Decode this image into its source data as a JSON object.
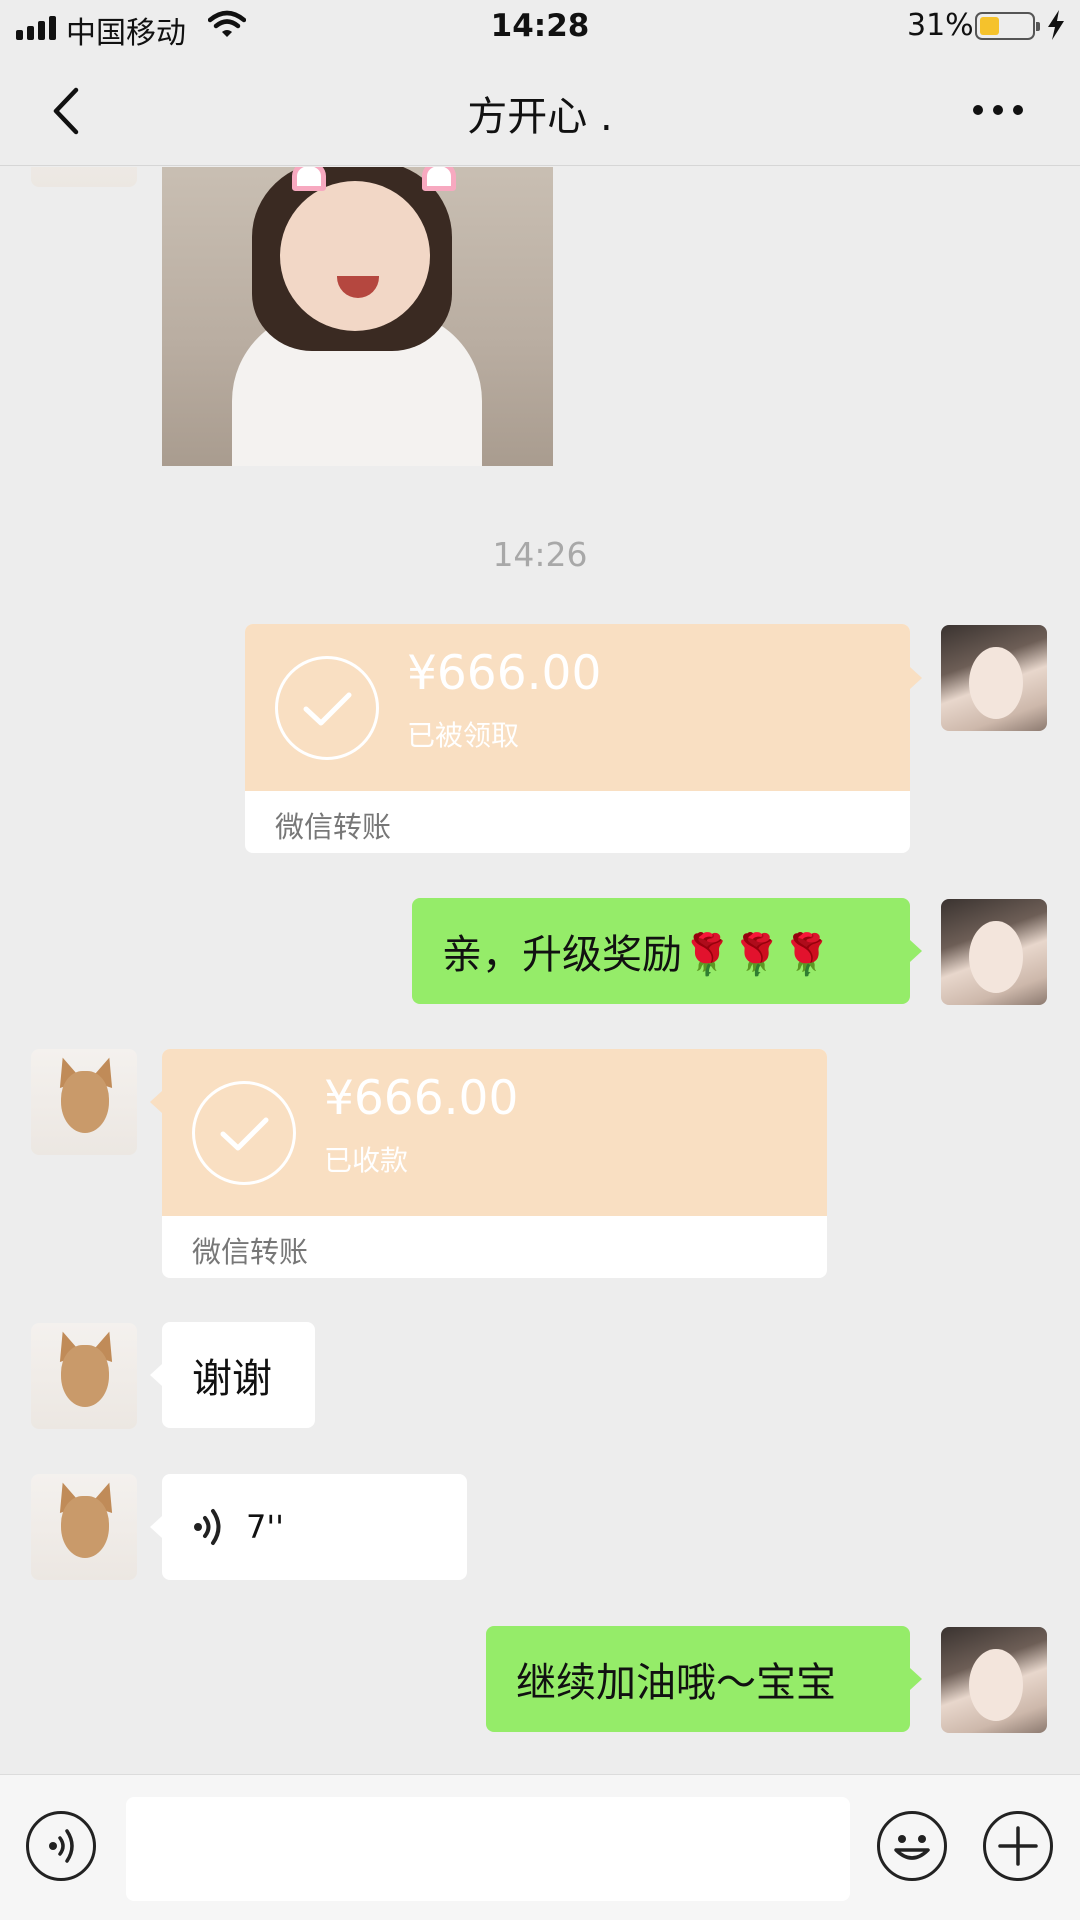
{
  "status_bar": {
    "carrier": "中国移动",
    "time": "14:28",
    "battery_percent": "31%",
    "battery_level": 0.31,
    "icons": [
      "signal-icon",
      "wifi-icon",
      "battery-icon",
      "charging-bolt-icon"
    ]
  },
  "nav": {
    "title": "方开心 .",
    "back_icon": "chevron-left-icon",
    "more_icon": "ellipsis-icon"
  },
  "chat": {
    "divider_time": "14:26",
    "messages": [
      {
        "type": "image",
        "side": "left",
        "sender": "contact",
        "description_icon": "photo"
      },
      {
        "type": "transfer",
        "side": "right",
        "sender": "self",
        "amount": "¥666.00",
        "status": "已被领取",
        "label": "微信转账"
      },
      {
        "type": "text",
        "side": "right",
        "sender": "self",
        "text": "亲，升级奖励🌹🌹🌹"
      },
      {
        "type": "transfer",
        "side": "left",
        "sender": "contact",
        "amount": "¥666.00",
        "status": "已收款",
        "label": "微信转账"
      },
      {
        "type": "text",
        "side": "left",
        "sender": "contact",
        "text": "谢谢"
      },
      {
        "type": "voice",
        "side": "left",
        "sender": "contact",
        "duration": "7''"
      },
      {
        "type": "text",
        "side": "right",
        "sender": "self",
        "text": "继续加油哦～宝宝"
      }
    ]
  },
  "input_bar": {
    "value": "",
    "icons": [
      "voice-mode-icon",
      "emoji-icon",
      "plus-icon"
    ]
  },
  "colors": {
    "background": "#ededed",
    "self_bubble": "#95ec69",
    "contact_bubble": "#ffffff",
    "transfer_card": "#f9dfc2",
    "battery_fill": "#f5c22c"
  }
}
